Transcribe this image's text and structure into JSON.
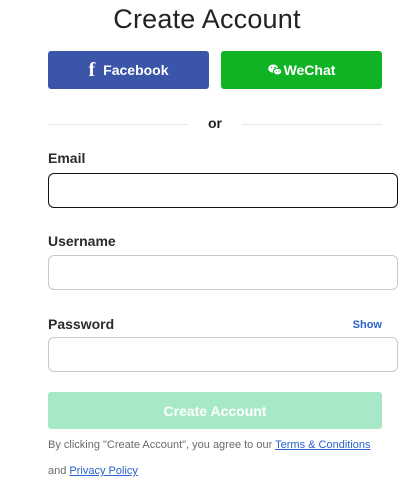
{
  "page": {
    "title": "Create Account"
  },
  "social": {
    "facebook_label": "Facebook",
    "facebook_icon": "f",
    "wechat_label": "WeChat"
  },
  "divider": {
    "text": "or"
  },
  "form": {
    "email_label": "Email",
    "email_value": "",
    "username_label": "Username",
    "username_value": "",
    "password_label": "Password",
    "password_value": "",
    "show_label": "Show",
    "submit_label": "Create Account"
  },
  "terms": {
    "prefix": "By clicking \"Create Account\", you agree to our ",
    "terms_link": "Terms & Conditions",
    "and": " and ",
    "privacy_link": "Privacy Policy"
  },
  "colors": {
    "facebook": "#3b55a8",
    "wechat": "#0fb323",
    "submit_disabled": "#a7e9c6",
    "link": "#2a62c9"
  }
}
